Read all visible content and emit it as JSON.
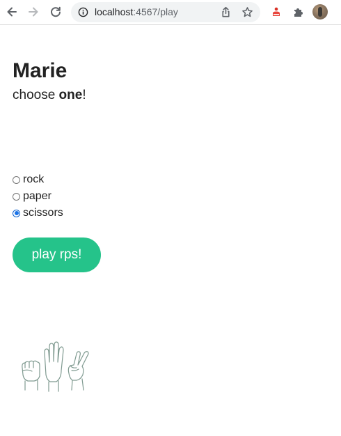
{
  "browser": {
    "url_host": "localhost",
    "url_rest": ":4567/play"
  },
  "page": {
    "player_name": "Marie",
    "instruction_prefix": "choose ",
    "instruction_emphasis": "one",
    "instruction_suffix": "!",
    "choices": [
      {
        "label": "rock",
        "checked": false
      },
      {
        "label": "paper",
        "checked": false
      },
      {
        "label": "scissors",
        "checked": true
      }
    ],
    "play_button_label": "play rps!"
  },
  "colors": {
    "accent": "#25c38a",
    "radio_checked": "#1a73e8"
  }
}
